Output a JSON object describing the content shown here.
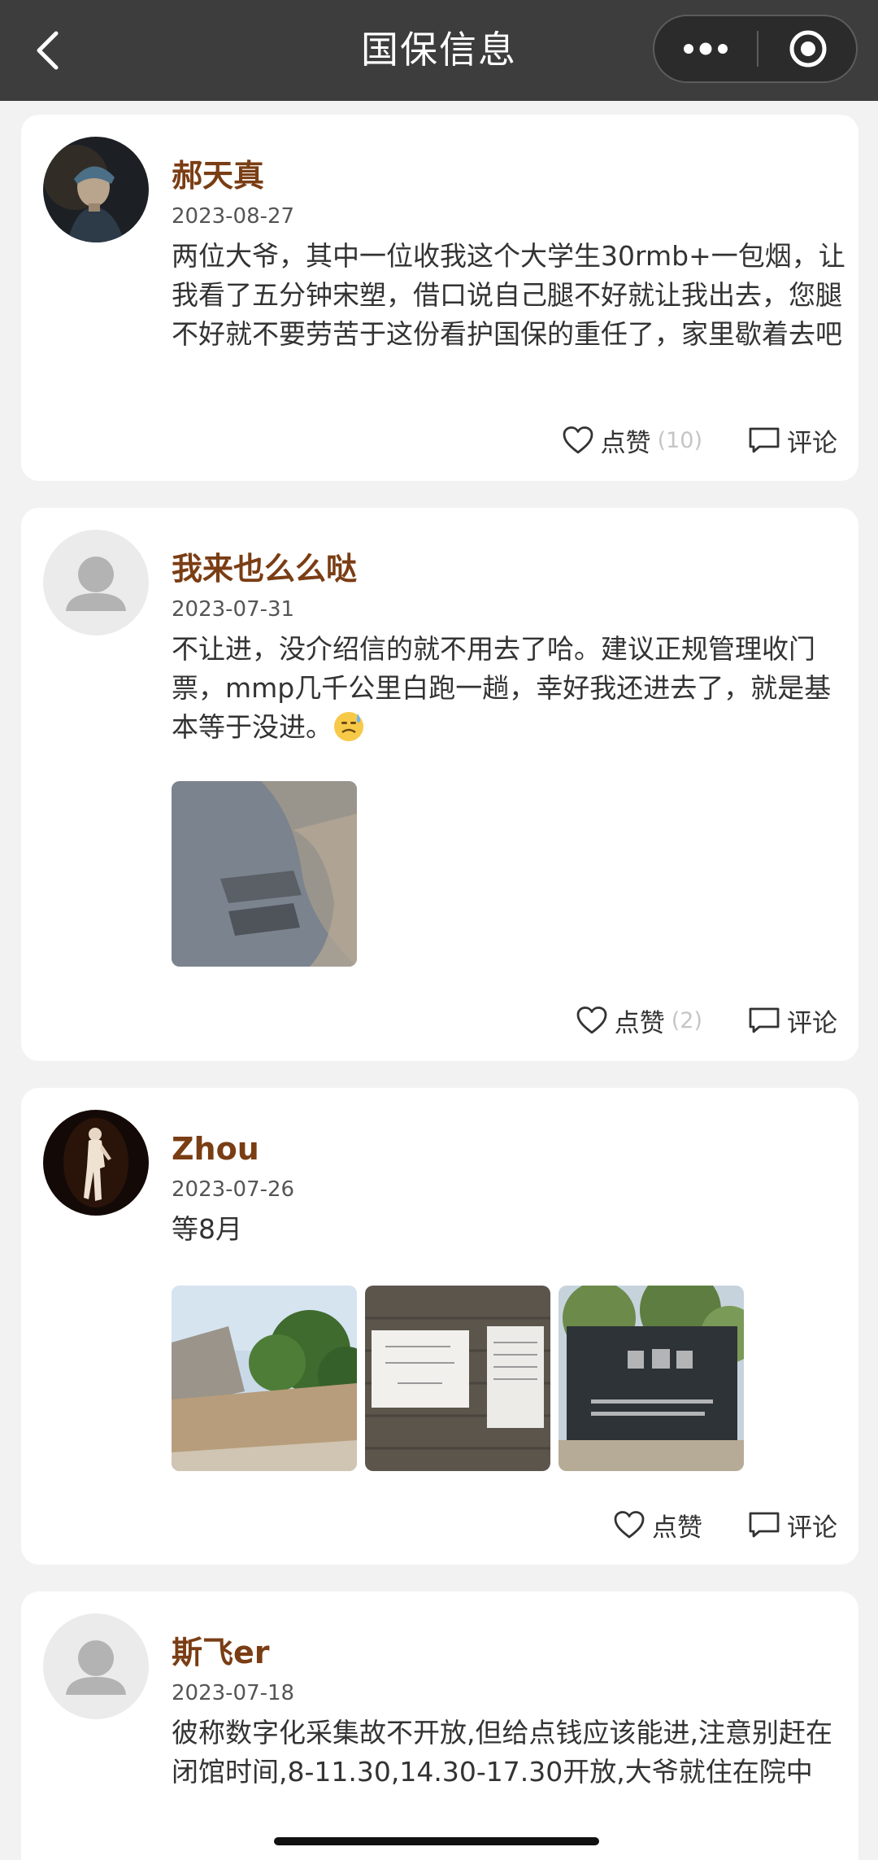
{
  "nav": {
    "title": "国保信息",
    "back_icon": "chevron-left-icon",
    "more_icon": "more-dots-icon",
    "close_icon": "target-circle-icon"
  },
  "posts": [
    {
      "username": "郝天真",
      "date": "2023-08-27",
      "content": "两位大爷，其中一位收我这个大学生30rmb+一包烟，让我看了五分钟宋塑，借口说自己腿不好就让我出去，您腿不好就不要劳苦于这份看护国保的重任了，家里歇着去吧",
      "like_label": "点赞",
      "like_count": "(10)",
      "comment_label": "评论"
    },
    {
      "username": "我来也么么哒",
      "date": "2023-07-31",
      "content": "不让进，没介绍信的就不用去了哈。建议正规管理收门票，mmp几千公里白跑一趟，幸好我还进去了，就是基本等于没进。",
      "emoji": "😓",
      "like_label": "点赞",
      "like_count": "(2)",
      "comment_label": "评论"
    },
    {
      "username": "Zhou",
      "date": "2023-07-26",
      "content": "等8月",
      "like_label": "点赞",
      "comment_label": "评论"
    },
    {
      "username": "斯飞er",
      "date": "2023-07-18",
      "content": "彼称数字化采集故不开放,但给点钱应该能进,注意别赶在闭馆时间,8-11.30,14.30-17.30开放,大爷就住在院中"
    }
  ],
  "colors": {
    "navbar": "#3d3d3d",
    "username": "#7a3d14",
    "background": "#f2f2f2"
  }
}
